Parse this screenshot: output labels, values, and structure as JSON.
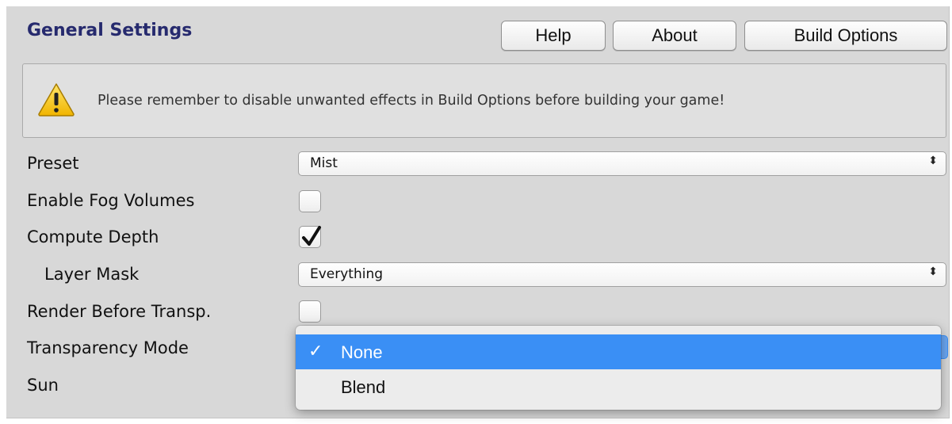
{
  "header": {
    "title": "General Settings",
    "buttons": {
      "help": "Help",
      "about": "About",
      "build_options": "Build Options"
    }
  },
  "warning": {
    "icon": "warning-icon",
    "message": "Please remember to disable unwanted effects in Build Options before building your game!"
  },
  "rows": {
    "preset": {
      "label": "Preset",
      "value": "Mist"
    },
    "enable_fog_volumes": {
      "label": "Enable Fog Volumes",
      "checked": false
    },
    "compute_depth": {
      "label": "Compute Depth",
      "checked": true
    },
    "layer_mask": {
      "label": "Layer Mask",
      "value": "Everything"
    },
    "render_before_transp": {
      "label": "Render Before Transp.",
      "checked": false
    },
    "transparency_mode": {
      "label": "Transparency Mode"
    },
    "sun": {
      "label": "Sun"
    }
  },
  "dropdown_menu": {
    "options": [
      {
        "label": "None",
        "selected": true,
        "check": "✓"
      },
      {
        "label": "Blend",
        "selected": false
      }
    ]
  },
  "colors": {
    "title": "#262a6e",
    "selection": "#3a8ff5",
    "panel_bg": "#d8d8d8"
  },
  "icons": {
    "popup_arrow": "⬍"
  }
}
